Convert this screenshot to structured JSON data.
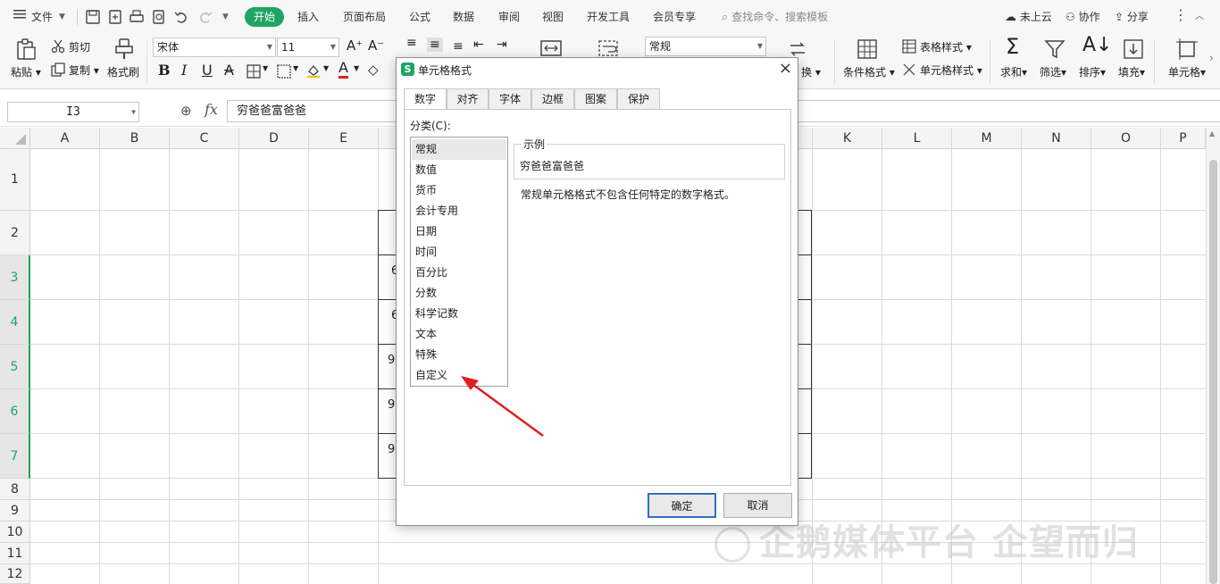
{
  "menu": {
    "file": "文件",
    "tabs": [
      "开始",
      "插入",
      "页面布局",
      "公式",
      "数据",
      "审阅",
      "视图",
      "开发工具",
      "会员专享"
    ],
    "search": "查找命令、搜索模板",
    "cloud": "未上云",
    "collab": "协作",
    "share": "分享"
  },
  "ribbon": {
    "paste": "粘贴",
    "cut": "剪切",
    "copy": "复制",
    "format_painter": "格式刷",
    "font_name": "宋体",
    "font_size": "11",
    "number_format": "常规",
    "convert": "换",
    "cond_format": "条件格式",
    "table_style": "表格样式",
    "cell_style": "单元格样式",
    "sum": "求和",
    "filter": "筛选",
    "sort": "排序",
    "fill": "填充",
    "cell": "单元格"
  },
  "formula_bar": {
    "name_box": "I3",
    "fx": "fx",
    "value": "穷爸爸富爸爸"
  },
  "sheet": {
    "columns": [
      "A",
      "B",
      "C",
      "D",
      "E",
      "K",
      "L",
      "M",
      "N",
      "O",
      "P"
    ],
    "rows": [
      "1",
      "2",
      "3",
      "4",
      "5",
      "6",
      "7",
      "8",
      "9",
      "10",
      "11",
      "12"
    ],
    "partial_cells": [
      "6",
      "6",
      "9",
      "9",
      "9"
    ]
  },
  "dialog": {
    "title": "单元格格式",
    "tabs": [
      "数字",
      "对齐",
      "字体",
      "边框",
      "图案",
      "保护"
    ],
    "category_label": "分类(C):",
    "categories": [
      "常规",
      "数值",
      "货币",
      "会计专用",
      "日期",
      "时间",
      "百分比",
      "分数",
      "科学记数",
      "文本",
      "特殊",
      "自定义"
    ],
    "sample_label": "示例",
    "sample_value": "穷爸爸富爸爸",
    "description": "常规单元格格式不包含任何特定的数字格式。",
    "ok": "确定",
    "cancel": "取消"
  },
  "watermark": "企鹅媒体平台 企望而归",
  "colors": {
    "accent": "#1fa463",
    "arrow": "#e02020"
  }
}
